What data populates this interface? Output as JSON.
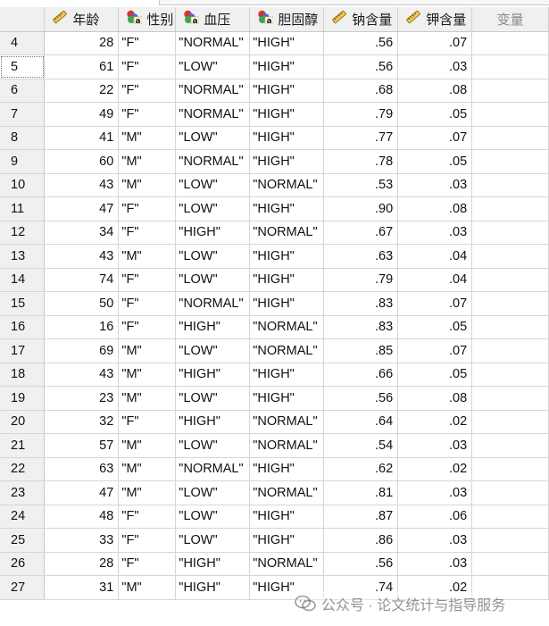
{
  "columns": [
    {
      "label": "年龄",
      "icon": "scale-icon",
      "type": "scale"
    },
    {
      "label": "性别",
      "icon": "nominal-icon",
      "type": "nominal"
    },
    {
      "label": "血压",
      "icon": "nominal-icon",
      "type": "nominal"
    },
    {
      "label": "胆固醇",
      "icon": "nominal-icon",
      "type": "nominal"
    },
    {
      "label": "钠含量",
      "icon": "scale-icon",
      "type": "scale"
    },
    {
      "label": "钾含量",
      "icon": "scale-icon",
      "type": "scale"
    },
    {
      "label": "变量",
      "icon": "",
      "type": "empty"
    }
  ],
  "selected_row": "5",
  "rows": [
    [
      "4",
      "28",
      "\"F\"",
      "\"NORMAL\"",
      "\"HIGH\"",
      ".56",
      ".07"
    ],
    [
      "5",
      "61",
      "\"F\"",
      "\"LOW\"",
      "\"HIGH\"",
      ".56",
      ".03"
    ],
    [
      "6",
      "22",
      "\"F\"",
      "\"NORMAL\"",
      "\"HIGH\"",
      ".68",
      ".08"
    ],
    [
      "7",
      "49",
      "\"F\"",
      "\"NORMAL\"",
      "\"HIGH\"",
      ".79",
      ".05"
    ],
    [
      "8",
      "41",
      "\"M\"",
      "\"LOW\"",
      "\"HIGH\"",
      ".77",
      ".07"
    ],
    [
      "9",
      "60",
      "\"M\"",
      "\"NORMAL\"",
      "\"HIGH\"",
      ".78",
      ".05"
    ],
    [
      "10",
      "43",
      "\"M\"",
      "\"LOW\"",
      "\"NORMAL\"",
      ".53",
      ".03"
    ],
    [
      "11",
      "47",
      "\"F\"",
      "\"LOW\"",
      "\"HIGH\"",
      ".90",
      ".08"
    ],
    [
      "12",
      "34",
      "\"F\"",
      "\"HIGH\"",
      "\"NORMAL\"",
      ".67",
      ".03"
    ],
    [
      "13",
      "43",
      "\"M\"",
      "\"LOW\"",
      "\"HIGH\"",
      ".63",
      ".04"
    ],
    [
      "14",
      "74",
      "\"F\"",
      "\"LOW\"",
      "\"HIGH\"",
      ".79",
      ".04"
    ],
    [
      "15",
      "50",
      "\"F\"",
      "\"NORMAL\"",
      "\"HIGH\"",
      ".83",
      ".07"
    ],
    [
      "16",
      "16",
      "\"F\"",
      "\"HIGH\"",
      "\"NORMAL\"",
      ".83",
      ".05"
    ],
    [
      "17",
      "69",
      "\"M\"",
      "\"LOW\"",
      "\"NORMAL\"",
      ".85",
      ".07"
    ],
    [
      "18",
      "43",
      "\"M\"",
      "\"HIGH\"",
      "\"HIGH\"",
      ".66",
      ".05"
    ],
    [
      "19",
      "23",
      "\"M\"",
      "\"LOW\"",
      "\"HIGH\"",
      ".56",
      ".08"
    ],
    [
      "20",
      "32",
      "\"F\"",
      "\"HIGH\"",
      "\"NORMAL\"",
      ".64",
      ".02"
    ],
    [
      "21",
      "57",
      "\"M\"",
      "\"LOW\"",
      "\"NORMAL\"",
      ".54",
      ".03"
    ],
    [
      "22",
      "63",
      "\"M\"",
      "\"NORMAL\"",
      "\"HIGH\"",
      ".62",
      ".02"
    ],
    [
      "23",
      "47",
      "\"M\"",
      "\"LOW\"",
      "\"NORMAL\"",
      ".81",
      ".03"
    ],
    [
      "24",
      "48",
      "\"F\"",
      "\"LOW\"",
      "\"HIGH\"",
      ".87",
      ".06"
    ],
    [
      "25",
      "33",
      "\"F\"",
      "\"LOW\"",
      "\"HIGH\"",
      ".86",
      ".03"
    ],
    [
      "26",
      "28",
      "\"F\"",
      "\"HIGH\"",
      "\"NORMAL\"",
      ".56",
      ".03"
    ],
    [
      "27",
      "31",
      "\"M\"",
      "\"HIGH\"",
      "\"HIGH\"",
      ".74",
      ".02"
    ]
  ],
  "watermark": {
    "text": "公众号 · 论文统计与指导服务",
    "icon": "wechat-icon"
  }
}
